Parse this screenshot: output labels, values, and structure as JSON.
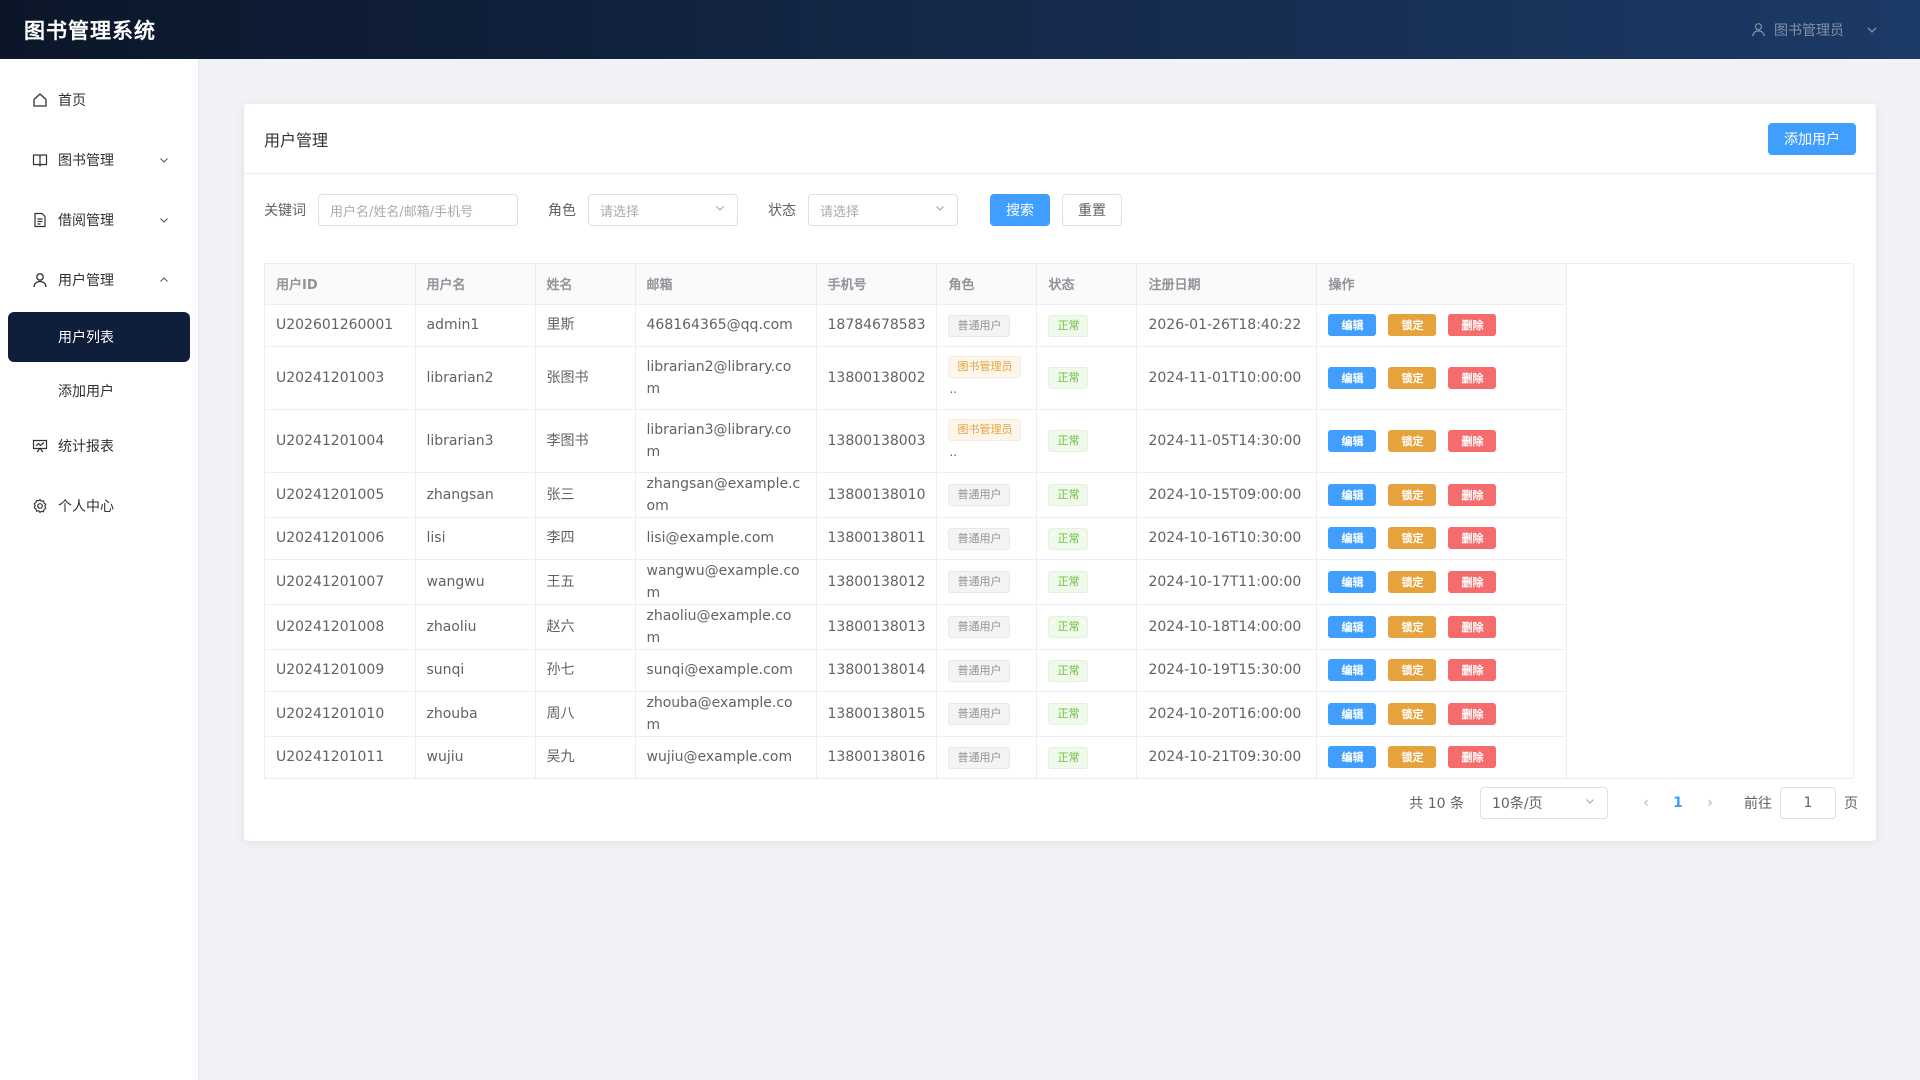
{
  "header": {
    "app_title": "图书管理系统",
    "user_name": "图书管理员"
  },
  "sidebar": {
    "items": [
      {
        "label": "首页"
      },
      {
        "label": "图书管理"
      },
      {
        "label": "借阅管理"
      },
      {
        "label": "用户管理"
      },
      {
        "label": "统计报表"
      },
      {
        "label": "个人中心"
      }
    ],
    "user_sub": [
      {
        "label": "用户列表"
      },
      {
        "label": "添加用户"
      }
    ]
  },
  "card": {
    "title": "用户管理",
    "add_button": "添加用户"
  },
  "filters": {
    "keyword_label": "关键词",
    "keyword_placeholder": "用户名/姓名/邮箱/手机号",
    "role_label": "角色",
    "role_placeholder": "请选择",
    "status_label": "状态",
    "status_placeholder": "请选择",
    "search_button": "搜索",
    "reset_button": "重置"
  },
  "table": {
    "columns": [
      "用户ID",
      "用户名",
      "姓名",
      "邮箱",
      "手机号",
      "角色",
      "状态",
      "注册日期",
      "操作"
    ],
    "actions": {
      "edit": "编辑",
      "lock": "锁定",
      "delete": "删除"
    },
    "rows": [
      {
        "id": "U202601260001",
        "username": "admin1",
        "name": "里斯",
        "email": "468164365@qq.com",
        "phone": "18784678583",
        "role": "普通用户",
        "role_type": "user",
        "status": "正常",
        "date": "2026-01-26T18:40:22"
      },
      {
        "id": "U20241201003",
        "username": "librarian2",
        "name": "张图书",
        "email": "librarian2@library.com",
        "phone": "13800138002",
        "role": "图书管理员",
        "role_type": "librarian",
        "status": "正常",
        "date": "2024-11-01T10:00:00"
      },
      {
        "id": "U20241201004",
        "username": "librarian3",
        "name": "李图书",
        "email": "librarian3@library.com",
        "phone": "13800138003",
        "role": "图书管理员",
        "role_type": "librarian",
        "status": "正常",
        "date": "2024-11-05T14:30:00"
      },
      {
        "id": "U20241201005",
        "username": "zhangsan",
        "name": "张三",
        "email": "zhangsan@example.com",
        "phone": "13800138010",
        "role": "普通用户",
        "role_type": "user",
        "status": "正常",
        "date": "2024-10-15T09:00:00"
      },
      {
        "id": "U20241201006",
        "username": "lisi",
        "name": "李四",
        "email": "lisi@example.com",
        "phone": "13800138011",
        "role": "普通用户",
        "role_type": "user",
        "status": "正常",
        "date": "2024-10-16T10:30:00"
      },
      {
        "id": "U20241201007",
        "username": "wangwu",
        "name": "王五",
        "email": "wangwu@example.com",
        "phone": "13800138012",
        "role": "普通用户",
        "role_type": "user",
        "status": "正常",
        "date": "2024-10-17T11:00:00"
      },
      {
        "id": "U20241201008",
        "username": "zhaoliu",
        "name": "赵六",
        "email": "zhaoliu@example.com",
        "phone": "13800138013",
        "role": "普通用户",
        "role_type": "user",
        "status": "正常",
        "date": "2024-10-18T14:00:00"
      },
      {
        "id": "U20241201009",
        "username": "sunqi",
        "name": "孙七",
        "email": "sunqi@example.com",
        "phone": "13800138014",
        "role": "普通用户",
        "role_type": "user",
        "status": "正常",
        "date": "2024-10-19T15:30:00"
      },
      {
        "id": "U20241201010",
        "username": "zhouba",
        "name": "周八",
        "email": "zhouba@example.com",
        "phone": "13800138015",
        "role": "普通用户",
        "role_type": "user",
        "status": "正常",
        "date": "2024-10-20T16:00:00"
      },
      {
        "id": "U20241201011",
        "username": "wujiu",
        "name": "吴九",
        "email": "wujiu@example.com",
        "phone": "13800138016",
        "role": "普通用户",
        "role_type": "user",
        "status": "正常",
        "date": "2024-10-21T09:30:00"
      }
    ]
  },
  "pagination": {
    "total": "共 10 条",
    "page_size": "10条/页",
    "current": "1",
    "prev": "‹",
    "next": "›",
    "goto_label": "前往",
    "goto_value": "1",
    "goto_unit": "页"
  },
  "colors": {
    "primary": "#409eff",
    "warning": "#e6a23c",
    "danger": "#f56c6c",
    "success": "#67c23a",
    "header": "#0b1629",
    "active_menu": "#0f1f3b"
  },
  "icons": {
    "home": "home-icon",
    "book": "book-icon",
    "doc": "document-icon",
    "user": "user-icon",
    "stats": "chart-icon",
    "gear": "gear-icon"
  }
}
